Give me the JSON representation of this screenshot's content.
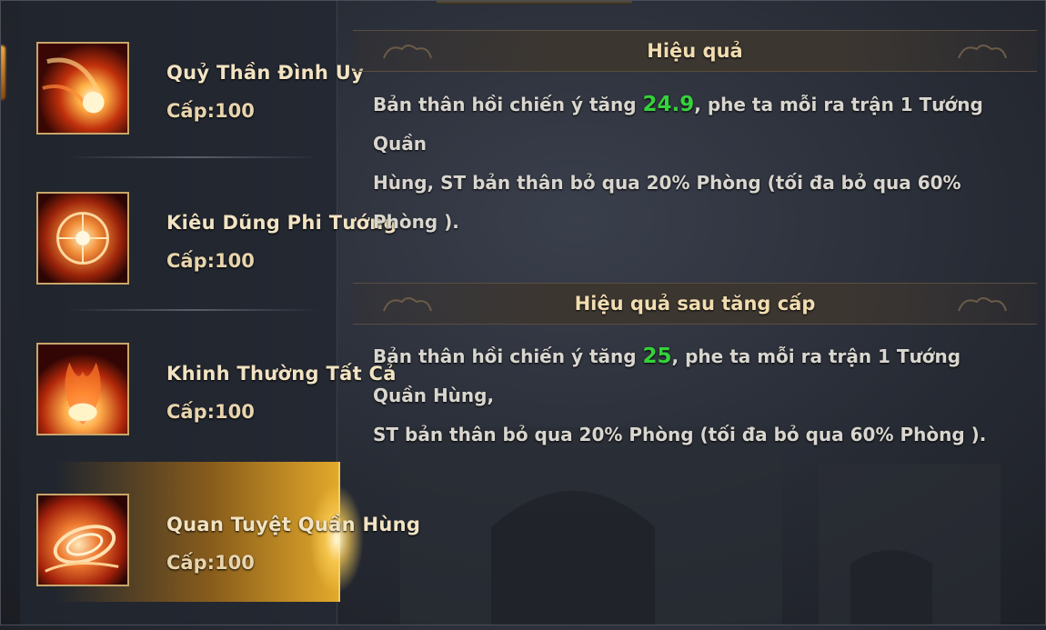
{
  "skills": [
    {
      "name": "Quỷ Thần Đình Uy",
      "level": "Cấp:100",
      "icon": "fire-orb-icon",
      "selected": false
    },
    {
      "name": "Kiêu Dũng Phi Tướng",
      "level": "Cấp:100",
      "icon": "fire-sphere-icon",
      "selected": false
    },
    {
      "name": "Khinh Thường Tất Cả",
      "level": "Cấp:100",
      "icon": "fire-burst-icon",
      "selected": false
    },
    {
      "name": "Quan Tuyệt Quần Hùng",
      "level": "Cấp:100",
      "icon": "fire-spiral-icon",
      "selected": true
    }
  ],
  "effect": {
    "title": "Hiệu quả",
    "line1_before": "Bản thân hồi chiến ý tăng ",
    "value": "24.9",
    "line1_after": ", phe ta mỗi ra trận 1 Tướng Quần",
    "line2": "Hùng, ST bản thân bỏ qua 20% Phòng (tối đa bỏ qua 60% Phòng )."
  },
  "upgrade": {
    "title": "Hiệu quả sau tăng cấp",
    "line1_before": "Bản thân hồi chiến ý tăng ",
    "value": "25",
    "line1_after": ", phe ta mỗi ra trận 1 Tướng Quần Hùng,",
    "line2": "ST bản thân bỏ qua 20% Phòng (tối đa bỏ qua 60% Phòng )."
  },
  "colors": {
    "highlight_value": "#35d23b",
    "accent_gold": "#e3a92a"
  }
}
